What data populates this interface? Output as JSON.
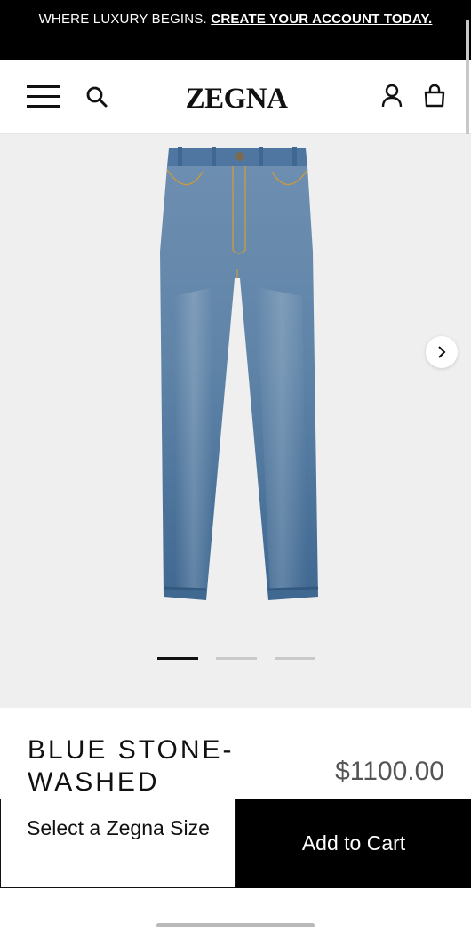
{
  "promo": {
    "text": "WHERE LUXURY BEGINS.",
    "link_text": "CREATE YOUR ACCOUNT TODAY."
  },
  "header": {
    "logo": "ZEGNA",
    "icons": [
      "menu-icon",
      "search-icon",
      "account-icon",
      "bag-icon"
    ]
  },
  "gallery": {
    "image": "blue stone-washed jeans",
    "slide_count": 3,
    "active_slide": 1,
    "next_icon": "chevron-right-icon",
    "colors": {
      "background": "#efefef",
      "denim": "#5d82a6"
    }
  },
  "product": {
    "title": "BLUE STONE-WASHED",
    "price": "$1100.00"
  },
  "cta": {
    "size_label": "Select a Zegna Size",
    "cart_label": "Add to Cart"
  },
  "colors": {
    "banner": "#000000",
    "accent": "#111111",
    "price": "#555555"
  }
}
